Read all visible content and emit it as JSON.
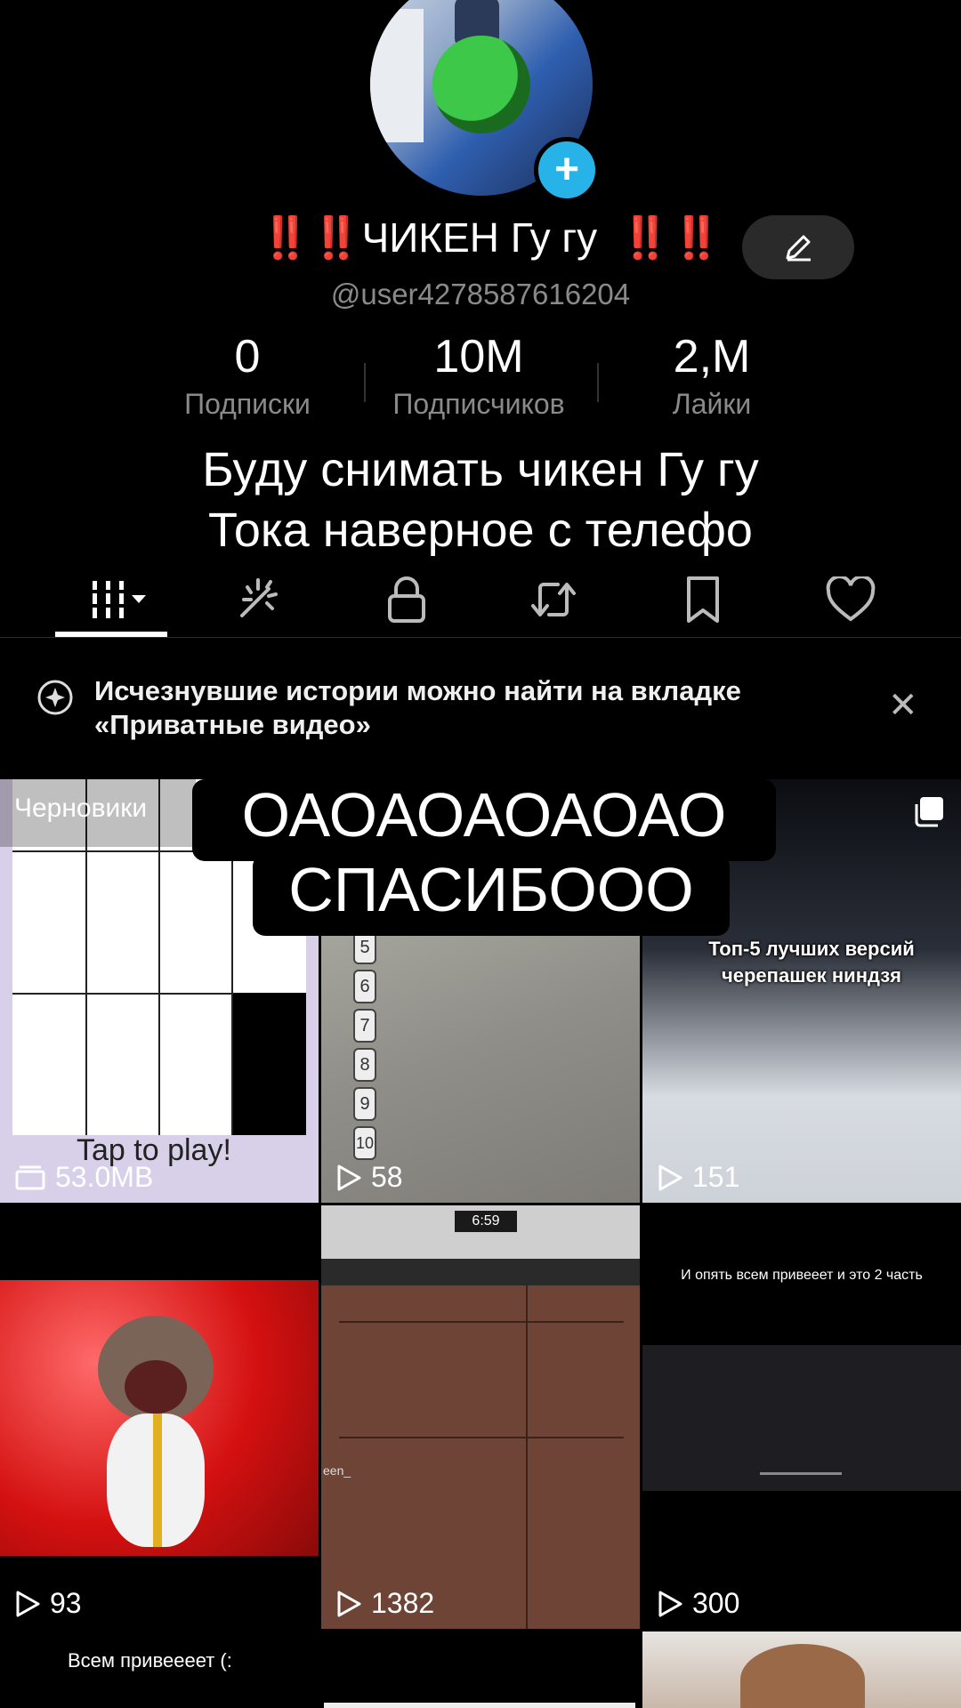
{
  "profile": {
    "name_prefix": "‼️‼️",
    "name_main": "ЧИКЕН  Гу гу",
    "name_suffix": "‼️‼️",
    "username": "@user4278587616204"
  },
  "stats": [
    {
      "value": "0",
      "label": "Подписки"
    },
    {
      "value": "10M",
      "label": "Подписчиков"
    },
    {
      "value": "2,M",
      "label": "Лайки"
    }
  ],
  "bio": {
    "line1": "Буду снимать чикен  Гу гу",
    "line2": "Тока наверное с телефо"
  },
  "tabs": [
    {
      "icon": "grid-icon",
      "active": true
    },
    {
      "icon": "sparkle-icon"
    },
    {
      "icon": "lock-icon"
    },
    {
      "icon": "repost-icon"
    },
    {
      "icon": "bookmark-icon"
    },
    {
      "icon": "heart-icon"
    }
  ],
  "notice": {
    "text": "Исчезнувшие истории можно найти на вкладке «Приватные видео»"
  },
  "overlay": {
    "line1": "ОАОАОАОАОАО",
    "line2": "СПАСИБООО"
  },
  "videos": {
    "drafts": {
      "label": "Черновики",
      "size": "53.0MB",
      "caption": "Tap to play!"
    },
    "v2": {
      "count": "58",
      "numbers": [
        "5",
        "6",
        "7",
        "8",
        "9",
        "10"
      ]
    },
    "v3": {
      "count": "151",
      "caption": "Топ-5 лучших версий черепашек ниндзя"
    },
    "v4": {
      "count": "93"
    },
    "v5": {
      "count": "1382",
      "clock": "6:59",
      "tag": "een_"
    },
    "v6": {
      "count": "300",
      "caption": "И опять всем привееет и это 2 часть"
    },
    "v7": {
      "caption": "Всем привеееет (:"
    }
  }
}
